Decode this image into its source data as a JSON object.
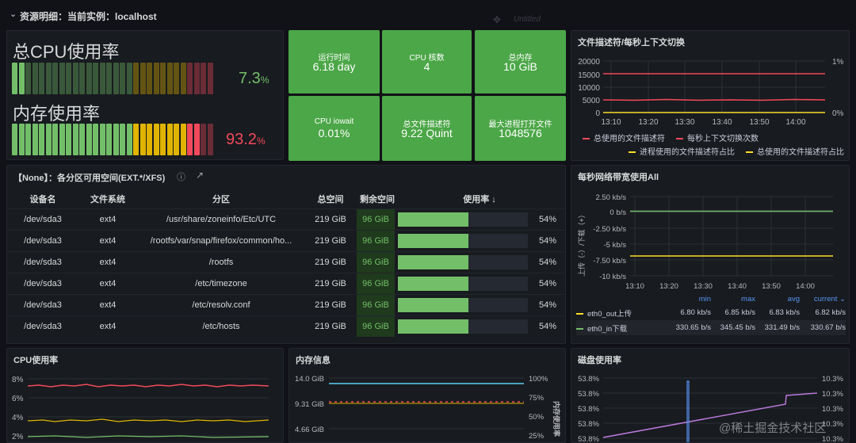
{
  "header": {
    "title": "资源明细：当前实例：localhost",
    "ghost": "Untitled"
  },
  "cpu_gauge": {
    "title": "总CPU使用率",
    "value": "7.3",
    "unit": "%",
    "level": 0.073,
    "color": "#73bf69"
  },
  "mem_gauge": {
    "title": "内存使用率",
    "value": "93.2",
    "unit": "%",
    "level": 0.932,
    "color": "#f2495c"
  },
  "stats": [
    {
      "label": "运行时间",
      "value": "6.18 day"
    },
    {
      "label": "CPU 核数",
      "value": "4"
    },
    {
      "label": "总内存",
      "value": "10 GiB"
    },
    {
      "label": "CPU iowait",
      "value": "0.01%"
    },
    {
      "label": "总文件描述符",
      "value": "9.22 Quint"
    },
    {
      "label": "最大进程打开文件",
      "value": "1048576"
    }
  ],
  "fd_panel": {
    "title": "文件描述符/每秒上下文切换",
    "left_ticks": [
      "20000",
      "15000",
      "10000",
      "5000",
      "0"
    ],
    "right_ticks": [
      "1%",
      "0%"
    ],
    "x_ticks": [
      "13:10",
      "13:20",
      "13:30",
      "13:40",
      "13:50",
      "14:00"
    ],
    "legend": [
      {
        "name": "总使用的文件描述符",
        "color": "#f2495c"
      },
      {
        "name": "每秒上下文切换次数",
        "color": "#f2495c"
      },
      {
        "name": "进程使用的文件描述符占比",
        "color": "#fade2a"
      },
      {
        "name": "总使用的文件描述符占比",
        "color": "#fade2a"
      }
    ]
  },
  "disk_table": {
    "title": "【None】：各分区可用空间(EXT.*/XFS)",
    "columns": [
      "设备名",
      "文件系统",
      "分区",
      "总空间",
      "剩余空间",
      "使用率 ↓"
    ],
    "rows": [
      {
        "dev": "/dev/sda3",
        "fs": "ext4",
        "mount": "/usr/share/zoneinfo/Etc/UTC",
        "total": "219 GiB",
        "free": "96 GiB",
        "usage": "54%",
        "level": 0.54
      },
      {
        "dev": "/dev/sda3",
        "fs": "ext4",
        "mount": "/rootfs/var/snap/firefox/common/ho...",
        "total": "219 GiB",
        "free": "96 GiB",
        "usage": "54%",
        "level": 0.54
      },
      {
        "dev": "/dev/sda3",
        "fs": "ext4",
        "mount": "/rootfs",
        "total": "219 GiB",
        "free": "96 GiB",
        "usage": "54%",
        "level": 0.54
      },
      {
        "dev": "/dev/sda3",
        "fs": "ext4",
        "mount": "/etc/timezone",
        "total": "219 GiB",
        "free": "96 GiB",
        "usage": "54%",
        "level": 0.54
      },
      {
        "dev": "/dev/sda3",
        "fs": "ext4",
        "mount": "/etc/resolv.conf",
        "total": "219 GiB",
        "free": "96 GiB",
        "usage": "54%",
        "level": 0.54
      },
      {
        "dev": "/dev/sda3",
        "fs": "ext4",
        "mount": "/etc/hosts",
        "total": "219 GiB",
        "free": "96 GiB",
        "usage": "54%",
        "level": 0.54
      }
    ]
  },
  "net_panel": {
    "title": "每秒网络带宽使用All",
    "y_ticks": [
      "2.50 kb/s",
      "0 b/s",
      "-2.50 kb/s",
      "-5 kb/s",
      "-7.50 kb/s",
      "-10 kb/s"
    ],
    "y_label": "上传（-）/下载（+）",
    "x_ticks": [
      "13:10",
      "13:20",
      "13:30",
      "13:40",
      "13:50",
      "14:00"
    ],
    "stat_headers": [
      "min",
      "max",
      "avg",
      "current ⌄"
    ],
    "rows": [
      {
        "name": "eth0_out上传",
        "color": "#fade2a",
        "min": "6.80 kb/s",
        "max": "6.85 kb/s",
        "avg": "6.83 kb/s",
        "current": "6.82 kb/s"
      },
      {
        "name": "eth0_in下载",
        "color": "#73bf69",
        "min": "330.65 b/s",
        "max": "345.45 b/s",
        "avg": "331.49 b/s",
        "current": "330.67 b/s"
      }
    ]
  },
  "cpu_panel": {
    "title": "CPU使用率",
    "y_ticks": [
      "8%",
      "6%",
      "4%",
      "2%"
    ]
  },
  "mem_panel": {
    "title": "内存信息",
    "left_ticks": [
      "14.0 GiB",
      "9.31 GiB",
      "4.66 GiB"
    ],
    "right_ticks": [
      "100%",
      "75%",
      "50%",
      "25%"
    ],
    "right_label": "内存使用率"
  },
  "diskuse_panel": {
    "title": "磁盘使用率",
    "left_ticks": [
      "53.8%",
      "53.8%",
      "53.8%",
      "53.8%",
      "53.8%"
    ],
    "right_ticks": [
      "10.3%",
      "10.3%",
      "10.3%",
      "10.3%",
      "10.3%"
    ]
  },
  "watermark": "@稀土掘金技术社区"
}
